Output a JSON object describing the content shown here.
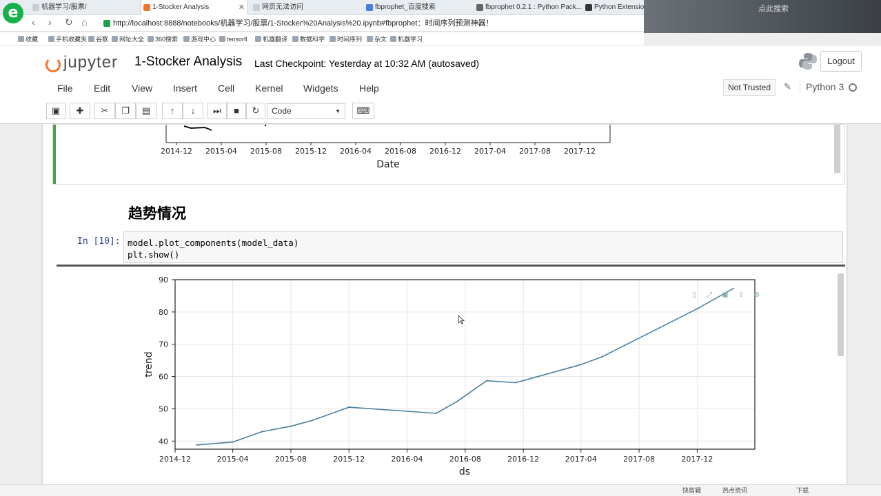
{
  "browser": {
    "tabs": [
      {
        "label": "机器学习/股票/"
      },
      {
        "label": "1-Stocker Analysis"
      },
      {
        "label": "网页无法访问"
      },
      {
        "label": "fbprophet_百度搜索"
      },
      {
        "label": "fbprophet 0.2.1 : Python Pack..."
      },
      {
        "label": "Python Extension Packages fo"
      }
    ],
    "url": "http://localhost:8888/notebooks/机器学习/股票/1-Stocker%20Analysis%20.ipynb#fbprophet：时间序列预测神器！",
    "search_hint": "点此搜索",
    "bookmarks": [
      "收藏",
      "手机收藏夹",
      "谷歌",
      "网址大全",
      "360搜索",
      "游戏中心",
      "tensorfl",
      "机器翻译",
      "数据科学",
      "时间序列",
      "杂文",
      "机器学习"
    ]
  },
  "jupyter": {
    "logo_text": "jupyter",
    "notebook_title": "1-Stocker Analysis",
    "checkpoint": "Last Checkpoint: Yesterday at 10:32 AM (autosaved)",
    "logout_label": "Logout",
    "menu": [
      "File",
      "Edit",
      "View",
      "Insert",
      "Cell",
      "Kernel",
      "Widgets",
      "Help"
    ],
    "trust_label": "Not Trusted",
    "kernel_name": "Python 3",
    "cell_type": "Code"
  },
  "notebook": {
    "heading": "趋势情况",
    "in_prompt": "In [10]:",
    "code": "model.plot_components(model_data)\nplt.show()"
  },
  "prev_chart": {
    "xlabel": "Date",
    "xticks": [
      "2014-12",
      "2015-04",
      "2015-08",
      "2015-12",
      "2016-04",
      "2016-08",
      "2016-12",
      "2017-04",
      "2017-08",
      "2017-12"
    ]
  },
  "chart_data": {
    "type": "line",
    "xlabel": "ds",
    "ylabel": "trend",
    "x_ticks": [
      "2014-12",
      "2015-04",
      "2015-08",
      "2015-12",
      "2016-04",
      "2016-08",
      "2016-12",
      "2017-04",
      "2017-08",
      "2017-12"
    ],
    "y_ticks": [
      40,
      50,
      60,
      70,
      80,
      90
    ],
    "xlim": [
      "2014-12-01",
      "2018-04-01"
    ],
    "ylim": [
      37.5,
      90
    ],
    "grid": true,
    "series": [
      {
        "x": [
          "2015-01-15",
          "2015-04-01",
          "2015-06-01",
          "2015-08-01",
          "2015-09-15",
          "2015-12-01",
          "2016-06-01",
          "2016-07-15",
          "2016-09-15",
          "2016-11-15",
          "2017-04-01",
          "2017-05-15",
          "2017-12-01",
          "2018-02-15"
        ],
        "y": [
          38.8,
          39.7,
          42.9,
          44.6,
          46.4,
          50.5,
          48.6,
          52.3,
          58.7,
          58.1,
          63.7,
          66.1,
          81.0,
          87.3
        ]
      }
    ]
  },
  "status_bar": {
    "items": [
      "快剪辑",
      "热点资讯",
      "下载"
    ]
  }
}
